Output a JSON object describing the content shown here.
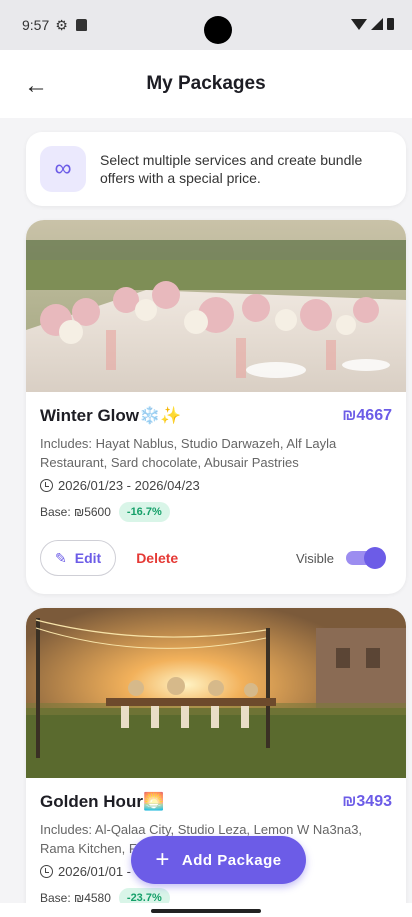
{
  "status": {
    "time": "9:57"
  },
  "appbar": {
    "title": "My Packages"
  },
  "info": {
    "text": "Select multiple services and create bundle offers with a special price."
  },
  "packages": [
    {
      "name": "Winter Glow❄️✨",
      "price": "₪4667",
      "includes": "Includes: Hayat Nablus, Studio Darwazeh, Alf Layla Restaurant, Sard chocolate, Abusair Pastries",
      "dates": "2026/01/23 - 2026/04/23",
      "base": "Base: ₪5600",
      "discount": "-16.7%",
      "edit_label": "Edit",
      "delete_label": "Delete",
      "visible_label": "Visible",
      "visible": true
    },
    {
      "name": "Golden Hour🌅",
      "price": "₪3493",
      "includes": "Includes: Al-Qalaa City, Studio Leza, Lemon W Na3na3, Rama Kitchen, F",
      "dates": "2026/01/01 -",
      "base": "Base: ₪4580",
      "discount": "-23.7%"
    }
  ],
  "fab": {
    "label": "Add Package"
  },
  "colors": {
    "accent": "#6c5ce7",
    "danger": "#e53935",
    "success": "#16a06a"
  }
}
